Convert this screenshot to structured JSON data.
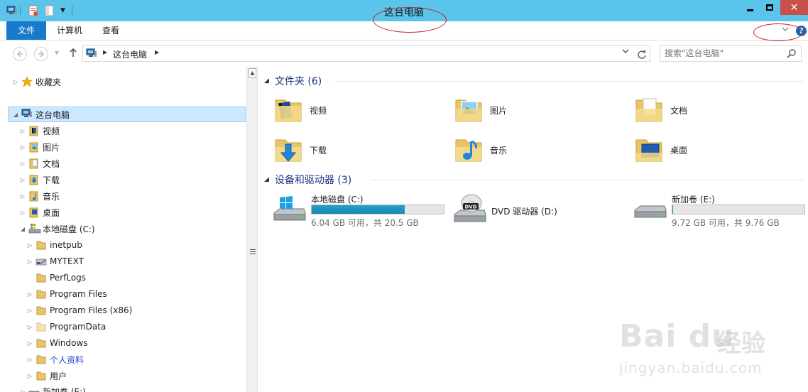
{
  "window": {
    "title": "这台电脑",
    "close_glyph": "✕"
  },
  "ribbon": {
    "tabs": [
      "文件",
      "计算机",
      "查看"
    ],
    "help_glyph": "?"
  },
  "address": {
    "path": "这台电脑",
    "search_placeholder": "搜索\"这台电脑\""
  },
  "navpane": {
    "items": [
      {
        "label": "收藏夹"
      },
      {
        "label": "这台电脑"
      },
      {
        "label": "视频"
      },
      {
        "label": "图片"
      },
      {
        "label": "文档"
      },
      {
        "label": "下载"
      },
      {
        "label": "音乐"
      },
      {
        "label": "桌面"
      },
      {
        "label": "本地磁盘 (C:)"
      },
      {
        "label": "inetpub"
      },
      {
        "label": "MYTEXT"
      },
      {
        "label": "PerfLogs"
      },
      {
        "label": "Program Files"
      },
      {
        "label": "Program Files (x86)"
      },
      {
        "label": "ProgramData"
      },
      {
        "label": "Windows"
      },
      {
        "label": "个人资料"
      },
      {
        "label": "用户"
      },
      {
        "label": "新加卷 (E:)"
      }
    ]
  },
  "content": {
    "folders_header": "文件夹 (6)",
    "folders": [
      {
        "label": "视频"
      },
      {
        "label": "图片"
      },
      {
        "label": "文档"
      },
      {
        "label": "下载"
      },
      {
        "label": "音乐"
      },
      {
        "label": "桌面"
      }
    ],
    "devices_header": "设备和驱动器 (3)",
    "drives": [
      {
        "name": "本地磁盘 (C:)",
        "free": "6.04 GB 可用，共 20.5 GB",
        "used_fraction": 0.705
      },
      {
        "name": "DVD 驱动器 (D:)",
        "free": ""
      },
      {
        "name": "新加卷 (E:)",
        "free": "9.72 GB 可用，共 9.76 GB",
        "used_fraction": 0.004
      }
    ]
  },
  "watermark": {
    "logo": "Bai du",
    "cn": "经验",
    "url": "jingyan.baidu.com"
  },
  "colors": {
    "titlebar": "#5bc4ea",
    "file_tab": "#1979ca",
    "close_button": "#c7504a",
    "drive_bar": "#1389b5",
    "group_header_text": "#1e3287"
  }
}
